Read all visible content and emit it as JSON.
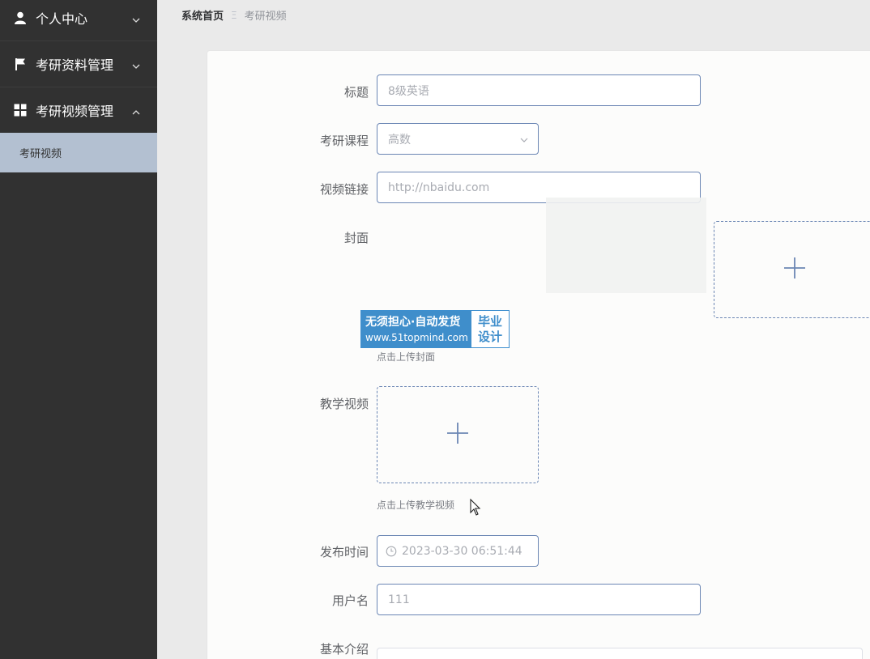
{
  "sidebar": {
    "items": [
      {
        "label": "个人中心",
        "icon": "person-icon",
        "expanded": false
      },
      {
        "label": "考研资料管理",
        "icon": "flag-icon",
        "expanded": false
      },
      {
        "label": "考研视频管理",
        "icon": "grid-icon",
        "expanded": true
      }
    ],
    "subitems": [
      {
        "label": "考研视频",
        "active": true
      }
    ]
  },
  "breadcrumb": {
    "home": "系统首页",
    "separator": "Ξ",
    "current": "考研视频"
  },
  "form": {
    "title": {
      "label": "标题",
      "value": "8级英语"
    },
    "course": {
      "label": "考研课程",
      "value": "高数"
    },
    "video_link": {
      "label": "视频链接",
      "value": "http://nbaidu.com"
    },
    "cover": {
      "label": "封面",
      "tip": "点击上传封面"
    },
    "teaching_video": {
      "label": "教学视频",
      "tip": "点击上传教学视频"
    },
    "publish_time": {
      "label": "发布时间",
      "value": "2023-03-30 06:51:44"
    },
    "username": {
      "label": "用户名",
      "value": "111"
    },
    "intro": {
      "label": "基本介绍"
    }
  },
  "watermark": {
    "main": "无须担心·自动发货",
    "url": "www.51topmind.com",
    "side_top": "毕业",
    "side_bottom": "设计"
  },
  "colors": {
    "sidebar_bg": "#313131",
    "active_menu_bg": "#b3c0d1",
    "input_border": "#6b86b4",
    "page_bg": "#eaeaea"
  }
}
